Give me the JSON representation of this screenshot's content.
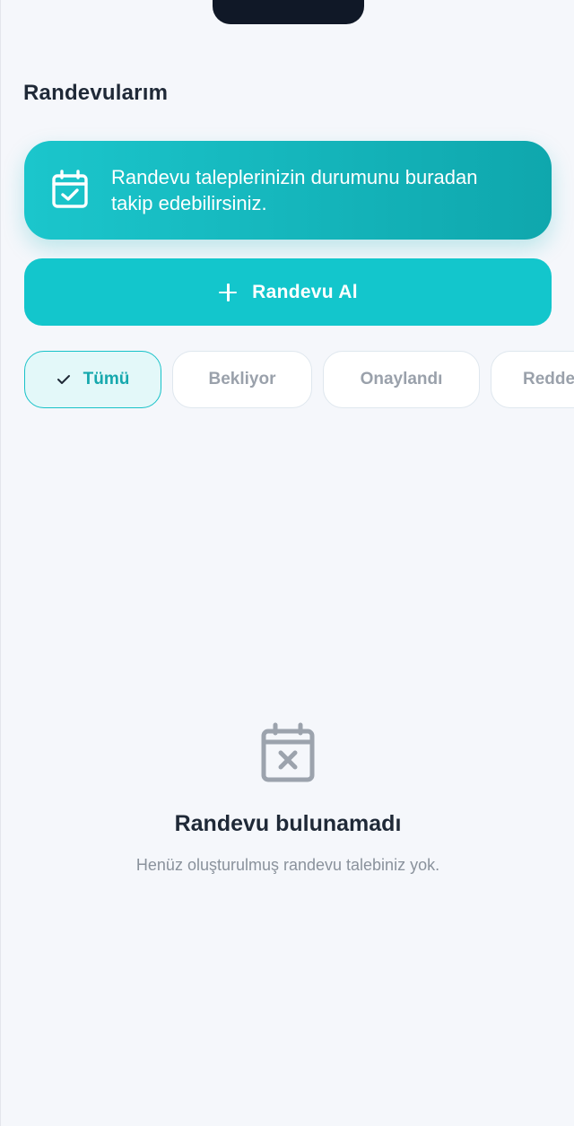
{
  "header": {
    "title": "Randevularım"
  },
  "info_card": {
    "icon": "calendar-check-icon",
    "text": "Randevu taleplerinizin durumunu buradan takip edebilirsiniz."
  },
  "primary_action": {
    "icon": "plus-icon",
    "label": "Randevu Al"
  },
  "filters": [
    {
      "label": "Tümü",
      "selected": true
    },
    {
      "label": "Bekliyor",
      "selected": false
    },
    {
      "label": "Onaylandı",
      "selected": false
    },
    {
      "label": "Redde",
      "selected": false
    }
  ],
  "empty_state": {
    "icon": "calendar-x-icon",
    "title": "Randevu bulunamadı",
    "subtitle": "Henüz oluşturulmuş randevu talebiniz yok."
  },
  "colors": {
    "accent": "#13c6cc",
    "accent_dark": "#0fa7ad",
    "background": "#f5f7fb",
    "text": "#1f2937",
    "muted": "#8a929c"
  }
}
